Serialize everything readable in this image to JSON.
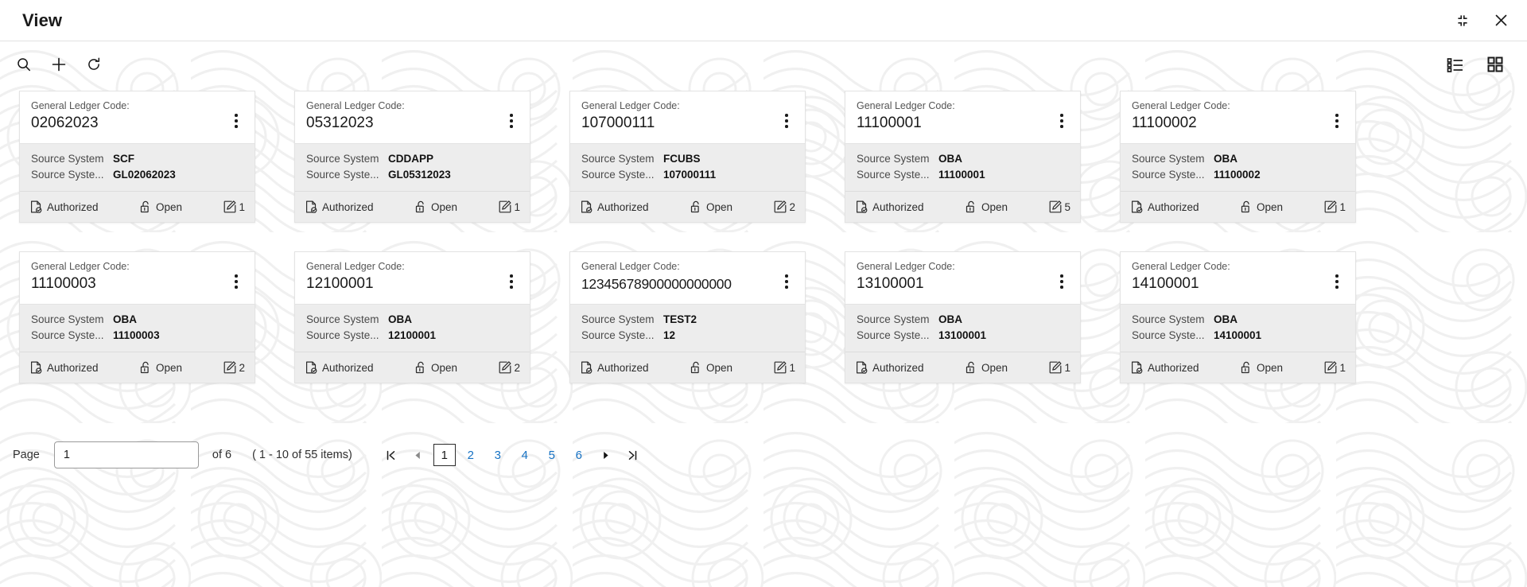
{
  "window": {
    "title": "View",
    "minimize_icon": "collapse-icon",
    "close_icon": "close-icon"
  },
  "toolbar": {
    "left_actions": [
      {
        "name": "search-icon",
        "label": "Search"
      },
      {
        "name": "add-icon",
        "label": "Add"
      },
      {
        "name": "refresh-icon",
        "label": "Refresh"
      }
    ],
    "right_actions": [
      {
        "name": "list-view-icon",
        "label": "List View"
      },
      {
        "name": "grid-view-icon",
        "label": "Grid View"
      }
    ]
  },
  "cards": {
    "header_label": "General Ledger Code:",
    "attr1_key": "Source System",
    "attr2_key": "Source Syste...",
    "status_label": "Authorized",
    "lock_label": "Open",
    "items": [
      {
        "code": "02062023",
        "source_system": "SCF",
        "source_system_id": "GL02062023",
        "status": "Authorized",
        "lock": "Open",
        "mods": "1"
      },
      {
        "code": "05312023",
        "source_system": "CDDAPP",
        "source_system_id": "GL05312023",
        "status": "Authorized",
        "lock": "Open",
        "mods": "1"
      },
      {
        "code": "107000111",
        "source_system": "FCUBS",
        "source_system_id": "107000111",
        "status": "Authorized",
        "lock": "Open",
        "mods": "2"
      },
      {
        "code": "11100001",
        "source_system": "OBA",
        "source_system_id": "11100001",
        "status": "Authorized",
        "lock": "Open",
        "mods": "5"
      },
      {
        "code": "11100002",
        "source_system": "OBA",
        "source_system_id": "11100002",
        "status": "Authorized",
        "lock": "Open",
        "mods": "1"
      },
      {
        "code": "11100003",
        "source_system": "OBA",
        "source_system_id": "11100003",
        "status": "Authorized",
        "lock": "Open",
        "mods": "2"
      },
      {
        "code": "12100001",
        "source_system": "OBA",
        "source_system_id": "12100001",
        "status": "Authorized",
        "lock": "Open",
        "mods": "2"
      },
      {
        "code": "12345678900000000000",
        "source_system": "TEST2",
        "source_system_id": "12",
        "status": "Authorized",
        "lock": "Open",
        "mods": "1"
      },
      {
        "code": "13100001",
        "source_system": "OBA",
        "source_system_id": "13100001",
        "status": "Authorized",
        "lock": "Open",
        "mods": "1"
      },
      {
        "code": "14100001",
        "source_system": "OBA",
        "source_system_id": "14100001",
        "status": "Authorized",
        "lock": "Open",
        "mods": "1"
      }
    ]
  },
  "pagination": {
    "page_word": "Page",
    "page_value": "1",
    "of_total": "of 6",
    "items_range": "( 1 - 10 of 55 items)",
    "first_icon": "first-page-icon",
    "prev_icon": "previous-page-icon",
    "next_icon": "next-page-icon",
    "last_icon": "last-page-icon",
    "pages": [
      "1",
      "2",
      "3",
      "4",
      "5",
      "6"
    ],
    "active_page": "1",
    "link_color": "#1672c4"
  }
}
